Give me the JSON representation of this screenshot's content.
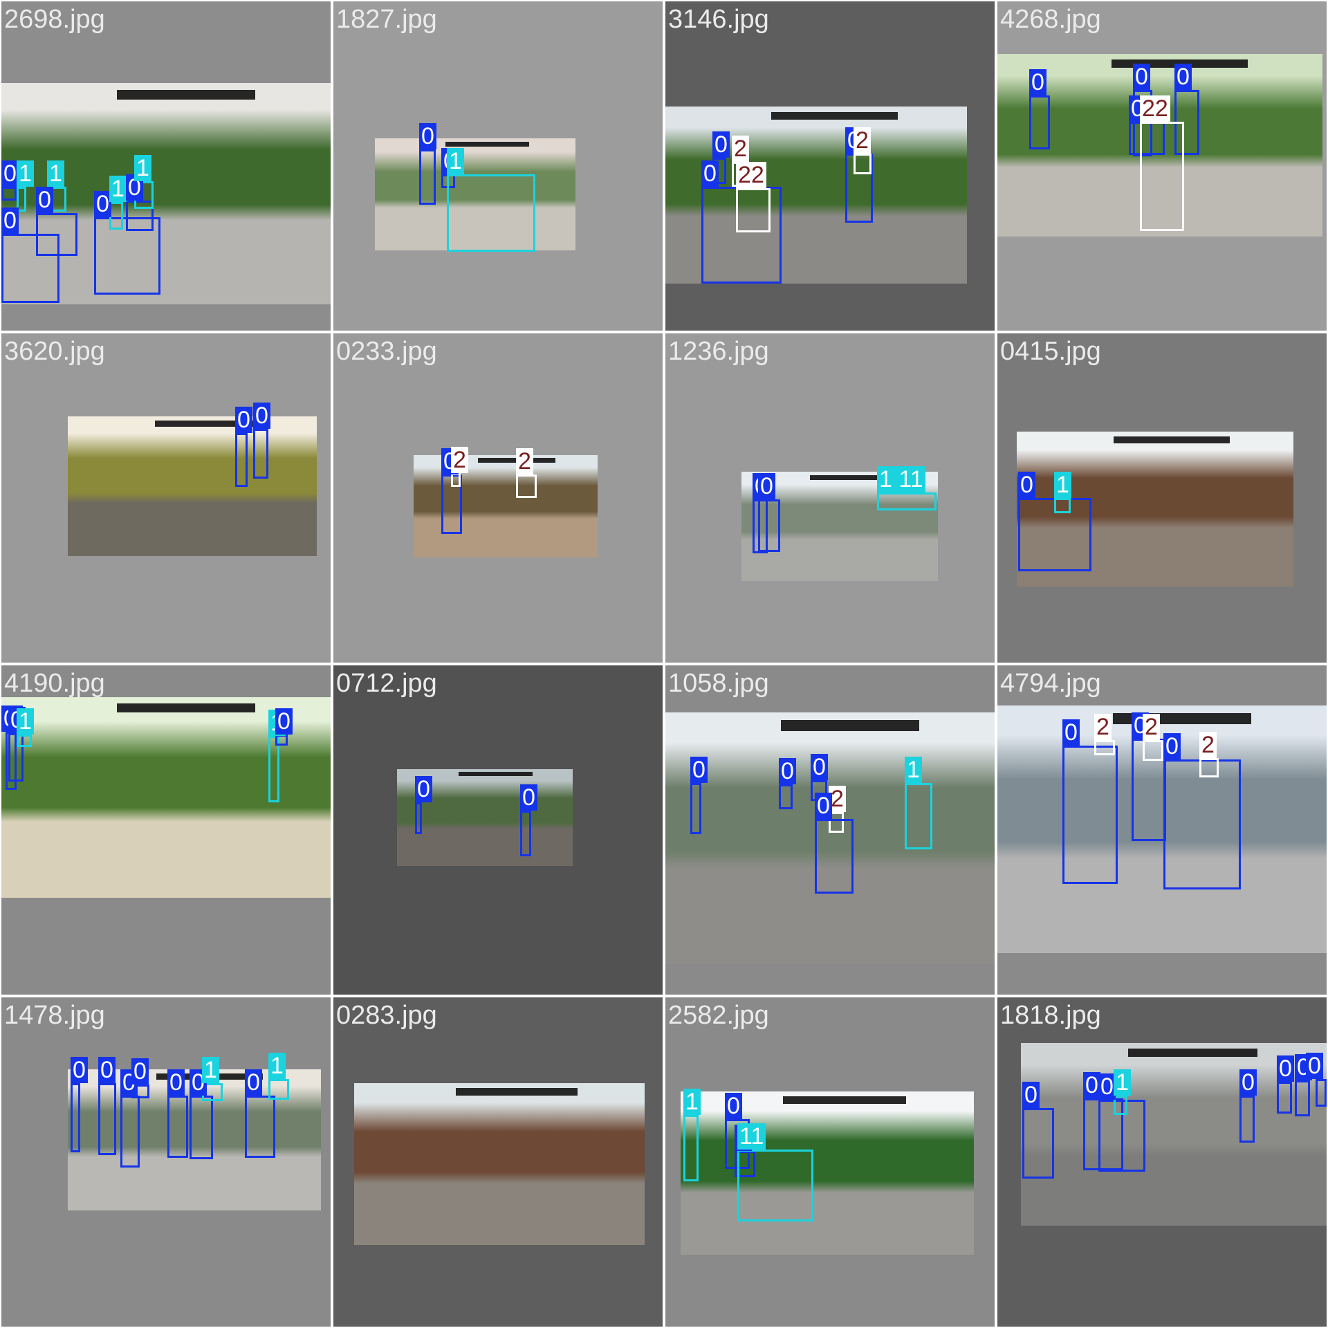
{
  "palette": {
    "class_0": "#1533e8",
    "class_1": "#1ad3de",
    "class_2": "#ffffff",
    "class_0_text": "#ffffff",
    "class_1_text": "#ffffff",
    "class_2_text": "#7a1f1f",
    "filename_text": "#ebebeb"
  },
  "tiles": [
    {
      "filename": "2698.jpg",
      "background": "#8d8d8d",
      "detections": [
        {
          "cls": "0",
          "label": "0"
        },
        {
          "cls": "1",
          "label": "1"
        },
        {
          "cls": "0",
          "label": "0"
        },
        {
          "cls": "1",
          "label": "1"
        },
        {
          "cls": "0",
          "label": "0"
        },
        {
          "cls": "1",
          "label": "1"
        },
        {
          "cls": "0",
          "label": "0"
        },
        {
          "cls": "1",
          "label": "1"
        },
        {
          "cls": "0",
          "label": "0"
        }
      ]
    },
    {
      "filename": "1827.jpg",
      "background": "#9c9c9c",
      "detections": [
        {
          "cls": "0",
          "label": "0"
        },
        {
          "cls": "0",
          "label": "0"
        },
        {
          "cls": "1",
          "label": "1"
        }
      ]
    },
    {
      "filename": "3146.jpg",
      "background": "#5e5e5e",
      "detections": [
        {
          "cls": "0",
          "label": "0"
        },
        {
          "cls": "2",
          "label": "2"
        },
        {
          "cls": "0",
          "label": "0"
        },
        {
          "cls": "2",
          "label": "22"
        },
        {
          "cls": "0",
          "label": "0"
        },
        {
          "cls": "2",
          "label": "2"
        }
      ]
    },
    {
      "filename": "4268.jpg",
      "background": "#9c9c9c",
      "detections": [
        {
          "cls": "0",
          "label": "0"
        },
        {
          "cls": "0",
          "label": "0"
        },
        {
          "cls": "0",
          "label": "0"
        },
        {
          "cls": "0",
          "label": "0"
        },
        {
          "cls": "2",
          "label": "22"
        }
      ]
    },
    {
      "filename": "3620.jpg",
      "background": "#9a9a9a",
      "detections": [
        {
          "cls": "0",
          "label": "0"
        },
        {
          "cls": "0",
          "label": "0"
        }
      ]
    },
    {
      "filename": "0233.jpg",
      "background": "#9a9a9a",
      "detections": [
        {
          "cls": "0",
          "label": "0"
        },
        {
          "cls": "2",
          "label": "2"
        },
        {
          "cls": "2",
          "label": "2"
        }
      ]
    },
    {
      "filename": "1236.jpg",
      "background": "#9a9a9a",
      "detections": [
        {
          "cls": "0",
          "label": "0"
        },
        {
          "cls": "0",
          "label": "0"
        },
        {
          "cls": "1",
          "label": "1 11"
        }
      ]
    },
    {
      "filename": "0415.jpg",
      "background": "#7a7a7a",
      "detections": [
        {
          "cls": "0",
          "label": "0"
        },
        {
          "cls": "1",
          "label": "1"
        }
      ]
    },
    {
      "filename": "4190.jpg",
      "background": "#8a8a8a",
      "detections": [
        {
          "cls": "0",
          "label": "0"
        },
        {
          "cls": "0",
          "label": "0"
        },
        {
          "cls": "0",
          "label": "0"
        },
        {
          "cls": "1",
          "label": "1"
        },
        {
          "cls": "1",
          "label": "1"
        },
        {
          "cls": "0",
          "label": "0"
        }
      ]
    },
    {
      "filename": "0712.jpg",
      "background": "#525252",
      "detections": [
        {
          "cls": "0",
          "label": "0"
        },
        {
          "cls": "0",
          "label": "0"
        }
      ]
    },
    {
      "filename": "1058.jpg",
      "background": "#8a8a8a",
      "detections": [
        {
          "cls": "0",
          "label": "0"
        },
        {
          "cls": "0",
          "label": "0"
        },
        {
          "cls": "0",
          "label": "0"
        },
        {
          "cls": "2",
          "label": "2"
        },
        {
          "cls": "0",
          "label": "0"
        },
        {
          "cls": "1",
          "label": "1"
        }
      ]
    },
    {
      "filename": "4794.jpg",
      "background": "#8a8a8a",
      "detections": [
        {
          "cls": "0",
          "label": "0"
        },
        {
          "cls": "2",
          "label": "2"
        },
        {
          "cls": "0",
          "label": "0"
        },
        {
          "cls": "2",
          "label": "2"
        },
        {
          "cls": "0",
          "label": "0"
        },
        {
          "cls": "2",
          "label": "2"
        }
      ]
    },
    {
      "filename": "1478.jpg",
      "background": "#8a8a8a",
      "detections": [
        {
          "cls": "0",
          "label": "0"
        },
        {
          "cls": "0",
          "label": "0"
        },
        {
          "cls": "0",
          "label": "0"
        },
        {
          "cls": "0",
          "label": "0"
        },
        {
          "cls": "0",
          "label": "0"
        },
        {
          "cls": "0",
          "label": "0"
        },
        {
          "cls": "1",
          "label": "1"
        },
        {
          "cls": "0",
          "label": "0"
        },
        {
          "cls": "1",
          "label": "1"
        }
      ]
    },
    {
      "filename": "0283.jpg",
      "background": "#5e5e5e",
      "detections": []
    },
    {
      "filename": "2582.jpg",
      "background": "#8a8a8a",
      "detections": [
        {
          "cls": "1",
          "label": "1"
        },
        {
          "cls": "0",
          "label": "0"
        },
        {
          "cls": "0",
          "label": "0"
        },
        {
          "cls": "1",
          "label": "11"
        }
      ]
    },
    {
      "filename": "1818.jpg",
      "background": "#5e5e5e",
      "detections": [
        {
          "cls": "0",
          "label": "0"
        },
        {
          "cls": "0",
          "label": "0"
        },
        {
          "cls": "0",
          "label": "0"
        },
        {
          "cls": "1",
          "label": "1"
        },
        {
          "cls": "0",
          "label": "0"
        },
        {
          "cls": "0",
          "label": "0"
        },
        {
          "cls": "0",
          "label": "0"
        },
        {
          "cls": "0",
          "label": "0"
        }
      ]
    }
  ]
}
